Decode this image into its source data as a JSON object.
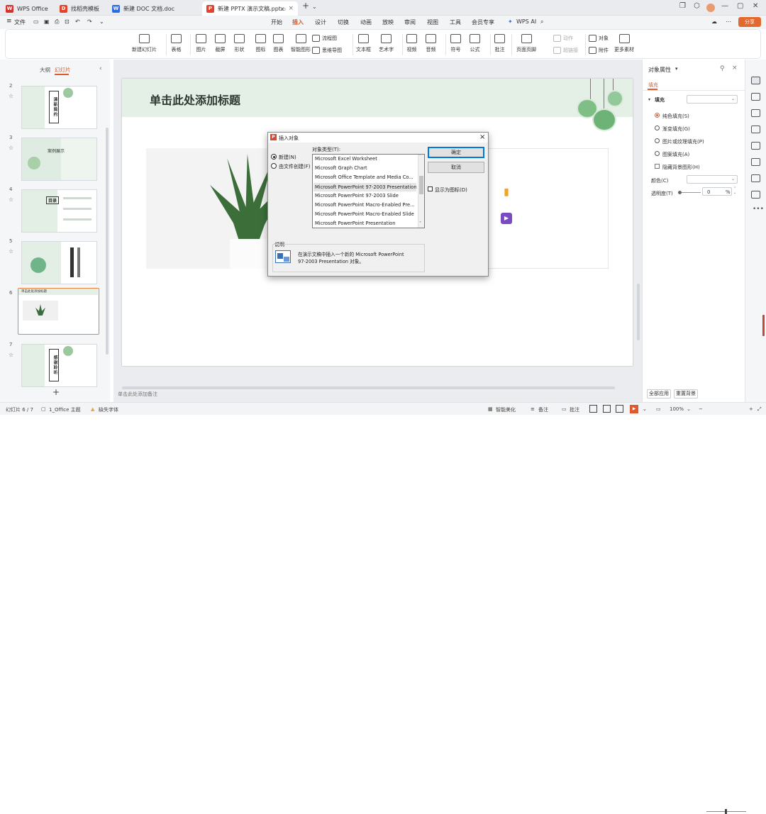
{
  "tabs": [
    {
      "label": "WPS Office"
    },
    {
      "label": "找稻壳模板"
    },
    {
      "label": "新建 DOC 文档.doc"
    },
    {
      "label": "新建 PPTX 演示文稿.pptx"
    }
  ],
  "menu": {
    "file": "文件",
    "items": [
      "开始",
      "插入",
      "设计",
      "切换",
      "动画",
      "放映",
      "审阅",
      "视图",
      "工具",
      "会员专享"
    ],
    "active_index": 1,
    "ai": "WPS AI",
    "share": "分享"
  },
  "ribbon": {
    "new_slide": "新建幻灯片",
    "table": "表格",
    "picture": "图片",
    "screenshot": "截屏",
    "shape": "形状",
    "icon": "图标",
    "chart": "图表",
    "smartart": "智能图形",
    "flowchart": "流程图",
    "mindmap": "思维导图",
    "textbox": "文本框",
    "wordart": "艺术字",
    "video": "视频",
    "audio": "音频",
    "symbol": "符号",
    "formula": "公式",
    "comment": "批注",
    "header_footer": "页面页脚",
    "action": "动作",
    "hyperlink": "超链接",
    "object": "对象",
    "attachment": "附件",
    "more": "更多素材"
  },
  "left_panel": {
    "tab_outline": "大纲",
    "tab_slides": "幻灯片",
    "thumbs": [
      {
        "num": "2",
        "text": "清新简约"
      },
      {
        "num": "3",
        "text": "案例展示"
      },
      {
        "num": "4",
        "text": "目录"
      },
      {
        "num": "5",
        "text": ""
      },
      {
        "num": "6",
        "text": "单击此处添加标题"
      },
      {
        "num": "7",
        "text": "感谢聆听"
      }
    ],
    "add": "+"
  },
  "slide": {
    "title": "单击此处添加标题",
    "notes_placeholder": "单击此处添加备注"
  },
  "dialog": {
    "title": "插入对象",
    "opt_new": "新建(N)",
    "opt_file": "由文件创建(F)",
    "type_label": "对象类型(T):",
    "types": [
      "Microsoft Excel Worksheet",
      "Microsoft Graph Chart",
      "Microsoft Office Template and Media Co...",
      "Microsoft PowerPoint 97-2003 Presentation",
      "Microsoft PowerPoint 97-2003 Slide",
      "Microsoft PowerPoint Macro-Enabled Pre...",
      "Microsoft PowerPoint Macro-Enabled Slide",
      "Microsoft PowerPoint Presentation"
    ],
    "selected_index": 3,
    "ok": "确定",
    "cancel": "取消",
    "show_as_icon": "显示为图标(D)",
    "desc_label": "说明",
    "desc_text_1": "在演示文稿中插入一个新的 Microsoft PowerPoint",
    "desc_text_2": "97-2003 Presentation 对象。"
  },
  "props": {
    "title": "对象属性",
    "tab_fill": "填充",
    "fill_label": "填充",
    "options": [
      "纯色填充(S)",
      "渐变填充(G)",
      "图片或纹理填充(P)",
      "图案填充(A)"
    ],
    "hide_bg": "隐藏背景图形(H)",
    "color_label": "颜色(C)",
    "transparency_label": "透明度(T)",
    "transparency_value": "0",
    "transparency_unit": "%",
    "apply_all": "全部应用",
    "reset_bg": "重置背景"
  },
  "status": {
    "slide_pos": "幻灯片 6 / 7",
    "theme": "1_Office 主题",
    "missing_font": "缺失字体",
    "smart_beautify": "智能美化",
    "notes": "备注",
    "comments": "批注",
    "zoom": "100%"
  },
  "colors": {
    "accent": "#e05a2a",
    "slide_banner": "#e4efe6",
    "dialog_bg": "#f0f0f0"
  }
}
